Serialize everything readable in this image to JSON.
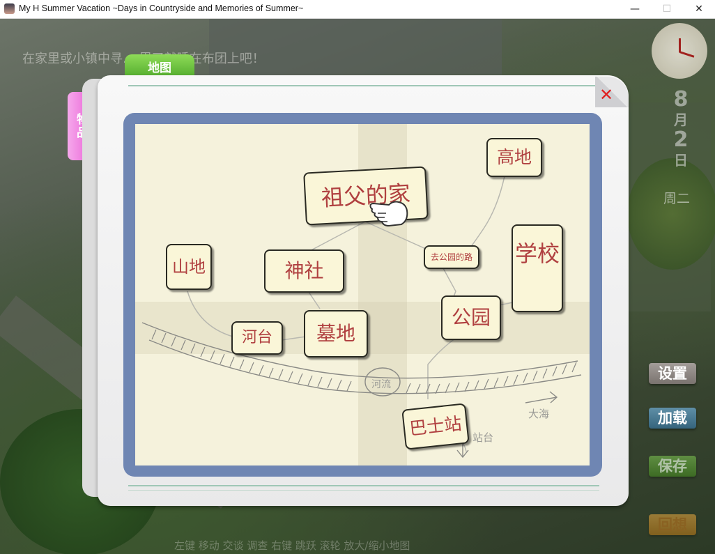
{
  "window": {
    "title": "My H Summer Vacation ~Days in Countryside and Memories of Summer~",
    "min_glyph": "—",
    "max_glyph": "☐",
    "close_glyph": "✕"
  },
  "hud": {
    "hint": "在家里或小镇中寻… 累了就睡在布团上吧！",
    "month": "8",
    "month_unit": "月",
    "day": "2",
    "day_unit": "日",
    "weekday": "周二",
    "bottom_help": "左键 移动   交谈   调查      右键 跳跃      滚轮 放大/缩小地图"
  },
  "tabs": {
    "map": "地图",
    "items": "物品"
  },
  "menu": {
    "settings": "设置",
    "load": "加载",
    "save": "保存",
    "extra": "回想"
  },
  "map": {
    "close_glyph": "✕",
    "locations": {
      "grandpa_house": "祖父的家",
      "highland": "高地",
      "mountain": "山地",
      "shrine": "神社",
      "park_road": "去公园的路",
      "school": "学校",
      "park": "公园",
      "riverbank": "河台",
      "graveyard": "墓地",
      "bus_stop": "巴士站"
    },
    "annotations": {
      "river": "河流",
      "sea": "大海",
      "station": "站台"
    }
  }
}
